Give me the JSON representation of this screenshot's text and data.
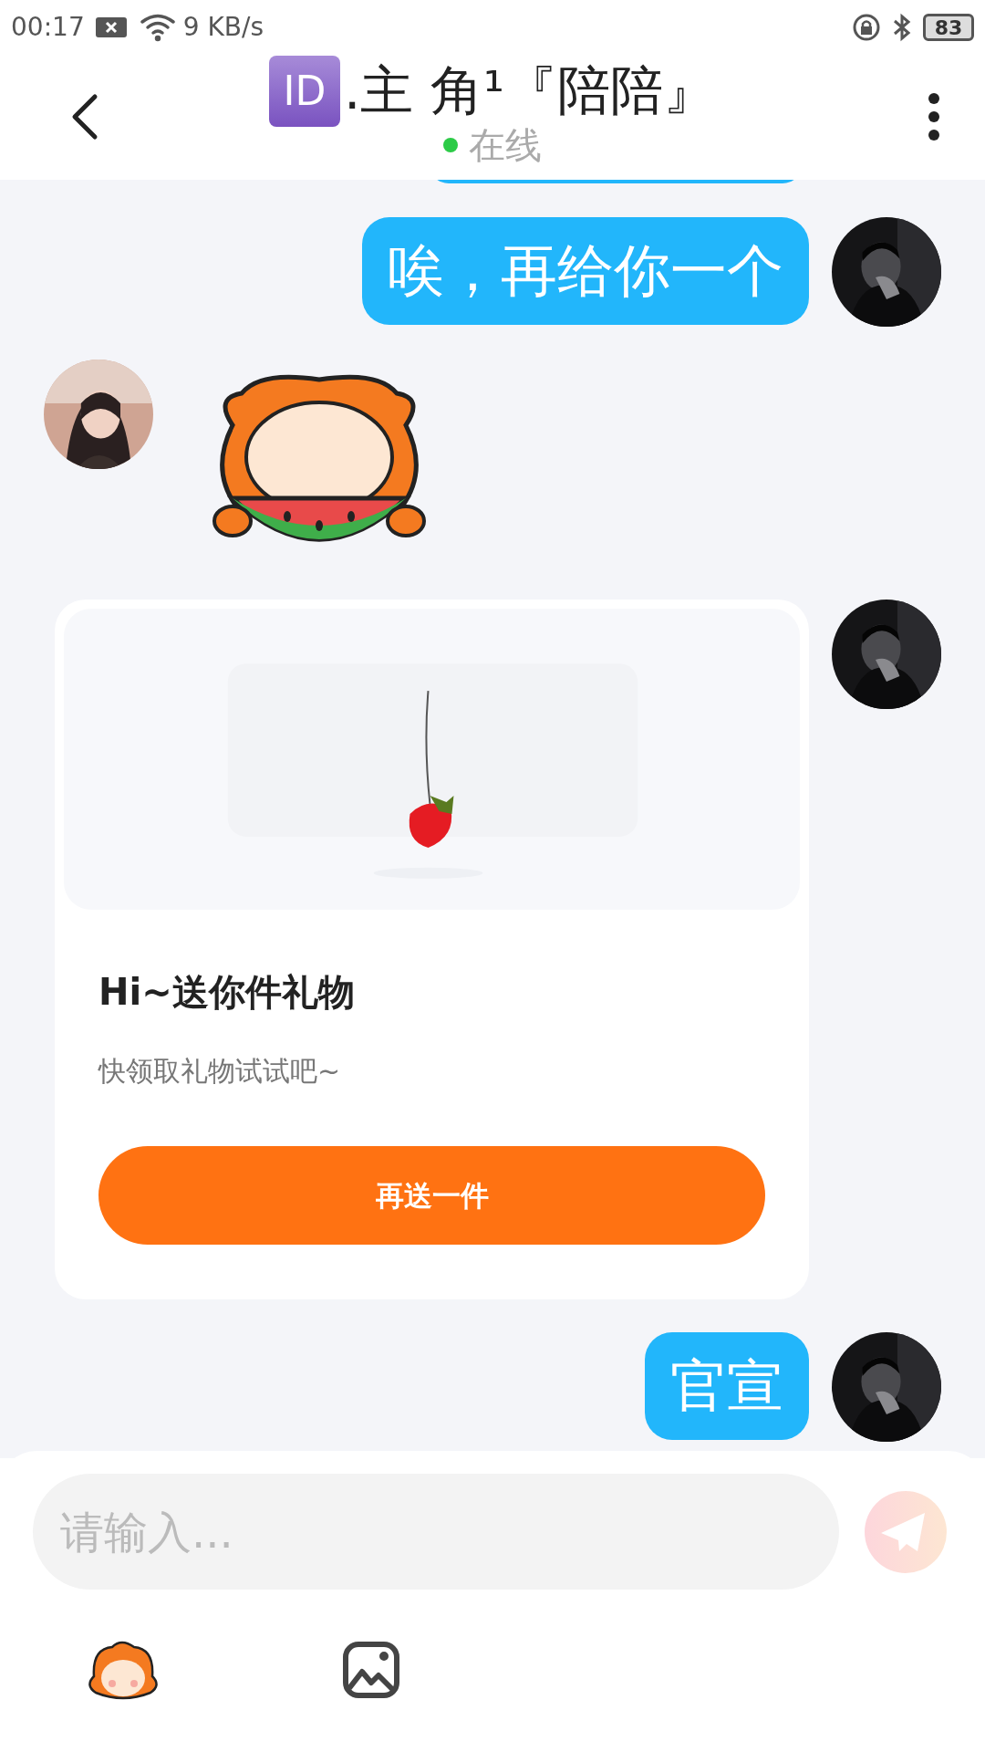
{
  "status_bar": {
    "time": "00:17",
    "speed": "9 KB/s",
    "battery": "83"
  },
  "header": {
    "badge": "ID",
    "title": ".主 角¹『陪陪』",
    "presence": "在线",
    "online": true
  },
  "messages": [
    {
      "kind": "text",
      "mine": true,
      "text": "唉，再给你一个"
    },
    {
      "kind": "sticker",
      "mine": false
    },
    {
      "kind": "gift",
      "mine": true,
      "title": "Hi~送你件礼物",
      "subtitle": "快领取礼物试试吧~",
      "button": "再送一件"
    },
    {
      "kind": "text",
      "mine": true,
      "text": "官宣"
    }
  ],
  "composer": {
    "placeholder": "请输入..."
  }
}
